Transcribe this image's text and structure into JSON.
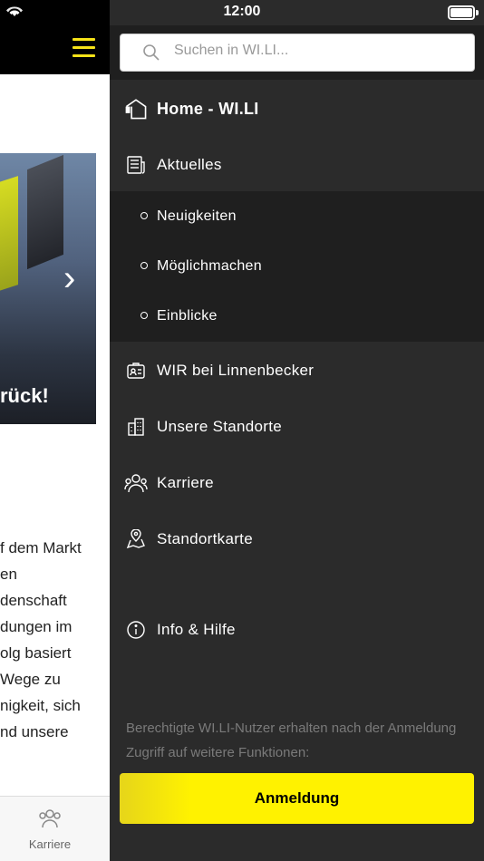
{
  "status": {
    "time": "12:00"
  },
  "background": {
    "hero_title": "rück!",
    "body_lines": [
      "f dem Markt",
      "en",
      "denschaft",
      "dungen im",
      "olg basiert",
      "Wege zu",
      "nigkeit, sich",
      "",
      "nd unsere"
    ],
    "tab_label": "Karriere"
  },
  "search": {
    "placeholder": "Suchen in WI.LI..."
  },
  "nav": {
    "home": "Home - WI.LI",
    "aktuelles": "Aktuelles",
    "sub": [
      "Neuigkeiten",
      "Möglichmachen",
      "Einblicke"
    ],
    "wir": "WIR bei Linnenbecker",
    "standorte": "Unsere Standorte",
    "karriere": "Karriere",
    "karte": "Standortkarte",
    "info": "Info & Hilfe"
  },
  "login": {
    "info_text": "Berechtigte WI.LI-Nutzer erhalten nach der Anmeldung Zugriff auf weitere Funktionen:",
    "button": "Anmeldung"
  },
  "colors": {
    "accent": "#fff200",
    "drawer": "#2b2b2b",
    "submenu": "#1f1f1f"
  }
}
